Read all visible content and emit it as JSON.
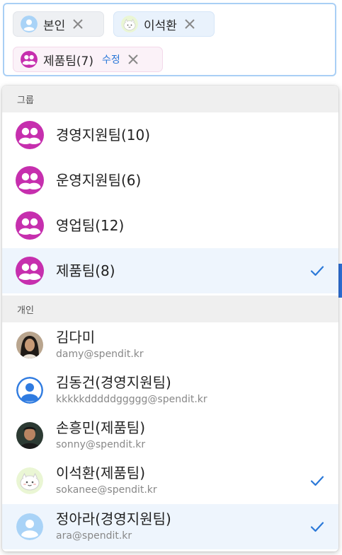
{
  "selected_chips": [
    {
      "label": "본인"
    },
    {
      "label": "이석환"
    },
    {
      "label": "제품팀(7)",
      "edit": "수정"
    }
  ],
  "dropdown": {
    "groups_header": "그룹",
    "groups": [
      {
        "label": "경영지원팀(10)",
        "selected": false
      },
      {
        "label": "운영지원팀(6)",
        "selected": false
      },
      {
        "label": "영업팀(12)",
        "selected": false
      },
      {
        "label": "제품팀(8)",
        "selected": true
      }
    ],
    "people_header": "개인",
    "people": [
      {
        "name": "김다미",
        "email": "damy@spendit.kr",
        "selected": false
      },
      {
        "name": "김동건(경영지원팀)",
        "email": "kkkkkdddddggggg@spendit.kr",
        "selected": false
      },
      {
        "name": "손흥민(제품팀)",
        "email": "sonny@spendit.kr",
        "selected": false
      },
      {
        "name": "이석환(제품팀)",
        "email": "sokanee@spendit.kr",
        "selected": true
      },
      {
        "name": "정아라(경영지원팀)",
        "email": "ara@spendit.kr",
        "selected": true
      }
    ]
  },
  "colors": {
    "accent": "#2a78d8",
    "group_avatar": "#c62fae",
    "selected_row_bg": "#eef5fd",
    "chip_border_focus": "#a9cff5"
  }
}
